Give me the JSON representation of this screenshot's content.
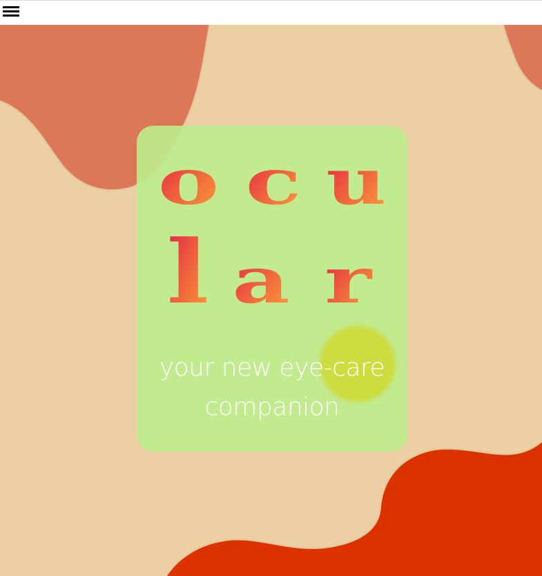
{
  "header": {
    "menu_icon": "hamburger-menu-icon"
  },
  "hero": {
    "logo_letters": [
      "o",
      "c",
      "u",
      "l",
      "a",
      "r"
    ],
    "tagline_line1": "your new eye-care",
    "tagline_line2": "companion"
  },
  "colors": {
    "background": "#eccfa3",
    "blob_terracotta": "#dc7858",
    "blob_red": "#dc3300",
    "card": "#c2ea8e",
    "card_blob": "#cddc3e",
    "logo_gradient_start": "#e31c48",
    "logo_gradient_end": "#ffa03c",
    "tagline": "#ffffff"
  }
}
